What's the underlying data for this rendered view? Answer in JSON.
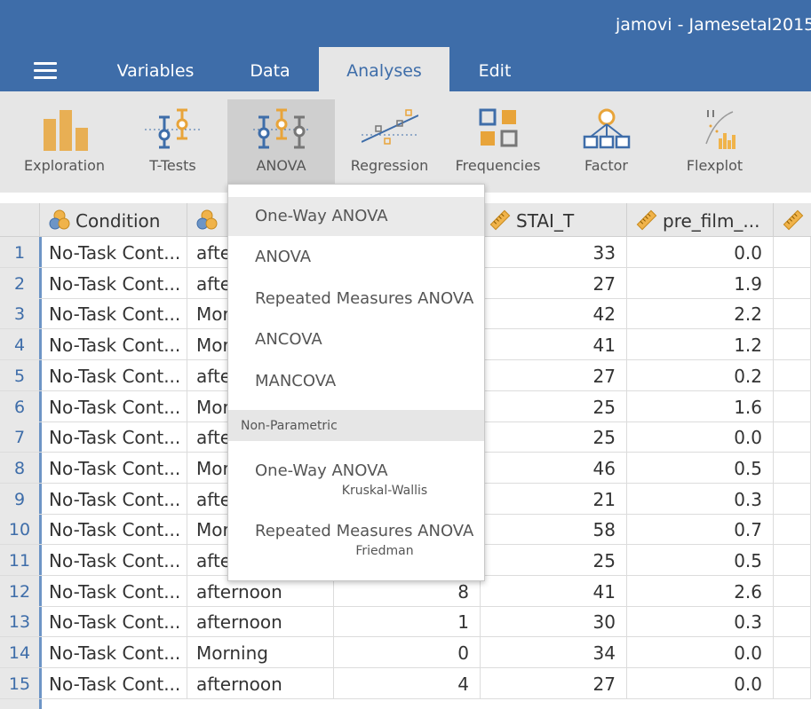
{
  "window": {
    "title": "jamovi - Jamesetal2015"
  },
  "menubar": {
    "tabs": [
      {
        "label": "Variables"
      },
      {
        "label": "Data"
      },
      {
        "label": "Analyses",
        "active": true
      },
      {
        "label": "Edit"
      }
    ]
  },
  "ribbon": {
    "buttons": [
      {
        "label": "Exploration",
        "icon": "exploration-icon"
      },
      {
        "label": "T-Tests",
        "icon": "ttests-icon"
      },
      {
        "label": "ANOVA",
        "icon": "anova-icon",
        "active": true
      },
      {
        "label": "Regression",
        "icon": "regression-icon"
      },
      {
        "label": "Frequencies",
        "icon": "frequencies-icon"
      },
      {
        "label": "Factor",
        "icon": "factor-icon"
      },
      {
        "label": "Flexplot",
        "icon": "flexplot-icon"
      }
    ]
  },
  "colors": {
    "brand": "#3e6da9",
    "accent": "#e8a43a",
    "nominal": "#f0b34a"
  },
  "grid": {
    "columns": [
      {
        "label": "Condition",
        "type": "nominal"
      },
      {
        "label": "",
        "type": "nominal"
      },
      {
        "label": "",
        "type": "continuous"
      },
      {
        "label": "STAI_T",
        "type": "continuous"
      },
      {
        "label": "pre_film_...",
        "type": "continuous"
      },
      {
        "label": "",
        "type": "continuous"
      }
    ],
    "rows": [
      {
        "n": "1",
        "condition": "No-Task Cont...",
        "time": "afte",
        "c3": "",
        "stai": "33",
        "pre": "0.0"
      },
      {
        "n": "2",
        "condition": "No-Task Cont...",
        "time": "afte",
        "c3": "",
        "stai": "27",
        "pre": "1.9"
      },
      {
        "n": "3",
        "condition": "No-Task Cont...",
        "time": "Mor",
        "c3": "",
        "stai": "42",
        "pre": "2.2"
      },
      {
        "n": "4",
        "condition": "No-Task Cont...",
        "time": "Mor",
        "c3": "",
        "stai": "41",
        "pre": "1.2"
      },
      {
        "n": "5",
        "condition": "No-Task Cont...",
        "time": "afte",
        "c3": "",
        "stai": "27",
        "pre": "0.2"
      },
      {
        "n": "6",
        "condition": "No-Task Cont...",
        "time": "Mor",
        "c3": "",
        "stai": "25",
        "pre": "1.6"
      },
      {
        "n": "7",
        "condition": "No-Task Cont...",
        "time": "afte",
        "c3": "",
        "stai": "25",
        "pre": "0.0"
      },
      {
        "n": "8",
        "condition": "No-Task Cont...",
        "time": "Mor",
        "c3": "",
        "stai": "46",
        "pre": "0.5"
      },
      {
        "n": "9",
        "condition": "No-Task Cont...",
        "time": "afte",
        "c3": "",
        "stai": "21",
        "pre": "0.3"
      },
      {
        "n": "10",
        "condition": "No-Task Cont...",
        "time": "Mor",
        "c3": "",
        "stai": "58",
        "pre": "0.7"
      },
      {
        "n": "11",
        "condition": "No-Task Cont...",
        "time": "afte",
        "c3": "",
        "stai": "25",
        "pre": "0.5"
      },
      {
        "n": "12",
        "condition": "No-Task Cont...",
        "time": "afternoon",
        "c3": "8",
        "stai": "41",
        "pre": "2.6"
      },
      {
        "n": "13",
        "condition": "No-Task Cont...",
        "time": "afternoon",
        "c3": "1",
        "stai": "30",
        "pre": "0.3"
      },
      {
        "n": "14",
        "condition": "No-Task Cont...",
        "time": "Morning",
        "c3": "0",
        "stai": "34",
        "pre": "0.0"
      },
      {
        "n": "15",
        "condition": "No-Task Cont...",
        "time": "afternoon",
        "c3": "4",
        "stai": "27",
        "pre": "0.0"
      }
    ]
  },
  "dropdown": {
    "items": [
      {
        "label": "One-Way ANOVA",
        "highlighted": true
      },
      {
        "label": "ANOVA"
      },
      {
        "label": "Repeated Measures ANOVA"
      },
      {
        "label": "ANCOVA"
      },
      {
        "label": "MANCOVA"
      }
    ],
    "section": "Non-Parametric",
    "nonparam": [
      {
        "label": "One-Way ANOVA",
        "sub": "Kruskal-Wallis"
      },
      {
        "label": "Repeated Measures ANOVA",
        "sub": "Friedman"
      }
    ]
  }
}
